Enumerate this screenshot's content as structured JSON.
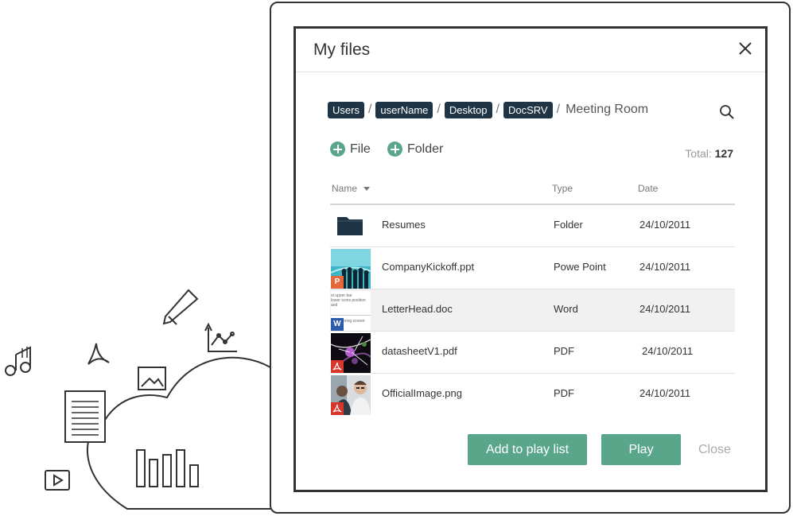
{
  "dialog": {
    "title": "My files"
  },
  "breadcrumb": {
    "crumbs": [
      "Users",
      "userName",
      "Desktop",
      "DocSRV"
    ],
    "separator": "/",
    "current": "Meeting Room"
  },
  "actions": {
    "add_file_label": "File",
    "add_folder_label": "Folder"
  },
  "total": {
    "label": "Total:",
    "count": "127"
  },
  "table": {
    "columns": [
      "Name",
      "Type",
      "Date"
    ],
    "rows": [
      {
        "name": "Resumes",
        "type": "Folder",
        "date": "24/10/2011"
      },
      {
        "name": "CompanyKickoff.ppt",
        "type": "Powe Point",
        "date": "24/10/2011"
      },
      {
        "name": "LetterHead.doc",
        "type": "Word",
        "date": "24/10/2011"
      },
      {
        "name": "datasheetV1.pdf",
        "type": "PDF",
        "date": "24/10/2011"
      },
      {
        "name": "OfficialImage.png",
        "type": "PDF",
        "date": "24/10/2011"
      }
    ],
    "doc_preview_lines": [
      "st upper bar",
      "lower icons position and",
      "ion entering screen"
    ],
    "badges": {
      "ppt": "P",
      "word": "W"
    }
  },
  "footer": {
    "add_playlist_label": "Add to play list",
    "play_label": "Play",
    "close_label": "Close"
  },
  "colors": {
    "accent": "#5aa68a",
    "crumb_bg": "#1f3545",
    "ppt_badge": "#e5683a",
    "word_badge": "#2a5caa",
    "pdf_badge": "#d9362b"
  }
}
